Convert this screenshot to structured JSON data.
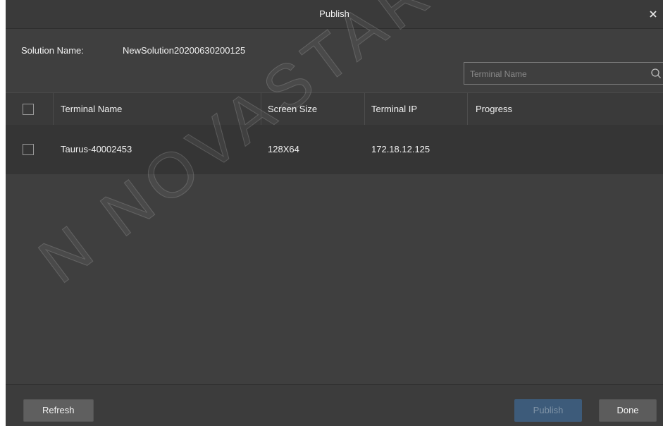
{
  "dialog": {
    "title": "Publish",
    "close_icon": "close-icon"
  },
  "solution": {
    "label": "Solution Name:",
    "value": "NewSolution20200630200125"
  },
  "search": {
    "placeholder": "Terminal Name",
    "value": "",
    "icon": "search-icon"
  },
  "table": {
    "columns": [
      "Terminal Name",
      "Screen Size",
      "Terminal IP",
      "Progress"
    ],
    "rows": [
      {
        "terminal_name": "Taurus-40002453",
        "screen_size": "128X64",
        "terminal_ip": "172.18.12.125",
        "progress": "",
        "checked": false
      }
    ],
    "select_all_checked": false
  },
  "footer": {
    "refresh_label": "Refresh",
    "publish_label": "Publish",
    "done_label": "Done"
  },
  "watermark": "N NOVASTAR TECH",
  "colors": {
    "background": "#3f3f3f",
    "header": "#3a3a3a",
    "row": "#353535",
    "publish_disabled": "#3d5b7a"
  }
}
